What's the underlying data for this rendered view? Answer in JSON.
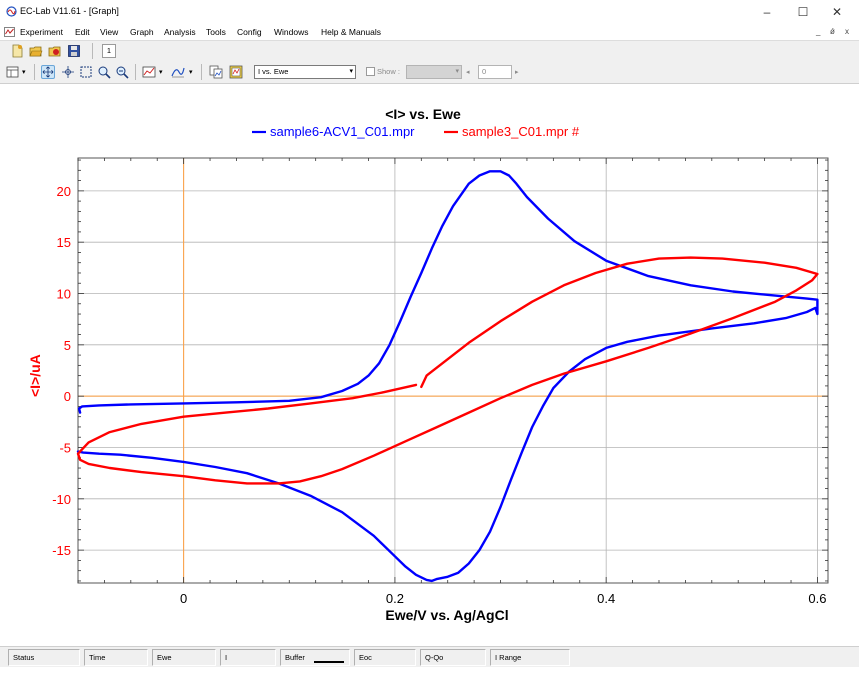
{
  "window": {
    "title": "EC-Lab V11.61 - [Graph]",
    "controls": [
      "–",
      "☐",
      "✕"
    ],
    "mdi_controls": [
      "_",
      "ǿ",
      "x"
    ]
  },
  "menubar": {
    "items": [
      "Experiment",
      "Edit",
      "View",
      "Graph",
      "Analysis",
      "Tools",
      "Config",
      "Windows",
      "Help & Manuals"
    ]
  },
  "toolbar": {
    "page_tab": "1",
    "graph_select": "I vs. Ewe",
    "show_label": "Show :",
    "spin_value": "0"
  },
  "statusbar": {
    "fields": [
      "Status",
      "Time",
      "Ewe",
      "I",
      "Buffer",
      "Eoc",
      "Q-Qo",
      "I Range"
    ]
  },
  "chart_data": {
    "type": "line",
    "title": "<I> vs. Ewe",
    "xlabel": "Ewe/V vs. Ag/AgCl",
    "ylabel": "<I>/uA",
    "xlim": [
      -0.1,
      0.61
    ],
    "ylim": [
      -18.2,
      23.2
    ],
    "xticks": [
      0,
      0.2,
      0.4,
      0.6
    ],
    "xtick_labels": [
      "0",
      "0.2",
      "0.4",
      "0.6"
    ],
    "yticks": [
      -15,
      -10,
      -5,
      0,
      5,
      10,
      15,
      20
    ],
    "ytick_labels": [
      "-15",
      "-10",
      "-5",
      "0",
      "5",
      "10",
      "15",
      "20"
    ],
    "grid": true,
    "legend_position": "top-center",
    "colors": {
      "axis_label": "#ff0000",
      "zero_line": "#ffa040",
      "grid": "#b4b4b4"
    },
    "series": [
      {
        "name": "sample6-ACV1_C01.mpr",
        "color": "#0000ff",
        "x": [
          -0.098,
          -0.099,
          -0.096,
          -0.08,
          -0.05,
          0,
          0.05,
          0.1,
          0.13,
          0.15,
          0.165,
          0.175,
          0.185,
          0.195,
          0.205,
          0.215,
          0.225,
          0.235,
          0.245,
          0.255,
          0.27,
          0.28,
          0.29,
          0.3,
          0.308,
          0.315,
          0.325,
          0.345,
          0.37,
          0.4,
          0.44,
          0.48,
          0.52,
          0.56,
          0.59,
          0.6,
          0.6,
          0.598,
          0.59,
          0.57,
          0.54,
          0.5,
          0.45,
          0.42,
          0.4,
          0.38,
          0.365,
          0.35,
          0.34,
          0.33,
          0.32,
          0.31,
          0.3,
          0.29,
          0.28,
          0.27,
          0.26,
          0.25,
          0.24,
          0.235,
          0.23,
          0.22,
          0.21,
          0.2,
          0.18,
          0.15,
          0.12,
          0.09,
          0.06,
          0.03,
          0,
          -0.03,
          -0.06,
          -0.08,
          -0.095,
          -0.1
        ],
        "y": [
          -1.6,
          -1.2,
          -1.0,
          -0.9,
          -0.8,
          -0.7,
          -0.6,
          -0.45,
          -0.1,
          0.5,
          1.2,
          2.0,
          3.2,
          5.0,
          7.3,
          9.7,
          12.0,
          14.4,
          16.6,
          18.5,
          20.7,
          21.5,
          21.9,
          21.9,
          21.5,
          20.7,
          19.4,
          17.3,
          15.1,
          13.2,
          11.7,
          10.8,
          10.2,
          9.8,
          9.5,
          9.4,
          8.0,
          8.6,
          8.2,
          7.6,
          7.1,
          6.6,
          5.9,
          5.3,
          4.7,
          3.6,
          2.4,
          0.8,
          -1.0,
          -3.0,
          -5.5,
          -8.1,
          -10.8,
          -13.2,
          -15.0,
          -16.3,
          -17.2,
          -17.6,
          -17.8,
          -18.0,
          -17.9,
          -17.4,
          -16.6,
          -15.6,
          -13.6,
          -11.3,
          -9.7,
          -8.5,
          -7.5,
          -6.9,
          -6.4,
          -6.0,
          -5.7,
          -5.6,
          -5.5,
          -5.4
        ]
      },
      {
        "name": "sample3_C01.mpr #",
        "color": "#ff0000",
        "x": [
          0.22,
          0.19,
          0.16,
          0.12,
          0.08,
          0.04,
          0,
          -0.04,
          -0.07,
          -0.09,
          -0.1,
          -0.098,
          -0.09,
          -0.07,
          -0.04,
          0,
          0.03,
          0.06,
          0.09,
          0.11,
          0.13,
          0.15,
          0.18,
          0.21,
          0.24,
          0.27,
          0.3,
          0.33,
          0.36,
          0.4,
          0.44,
          0.48,
          0.52,
          0.56,
          0.58,
          0.595,
          0.6,
          0.6,
          0.58,
          0.55,
          0.51,
          0.48,
          0.45,
          0.42,
          0.39,
          0.36,
          0.33,
          0.3,
          0.27,
          0.25,
          0.23,
          0.225
        ],
        "y": [
          1.1,
          0.4,
          -0.2,
          -0.7,
          -1.2,
          -1.6,
          -2.0,
          -2.7,
          -3.5,
          -4.5,
          -5.6,
          -6.2,
          -6.6,
          -7.0,
          -7.4,
          -7.8,
          -8.2,
          -8.5,
          -8.5,
          -8.3,
          -7.8,
          -7.1,
          -5.8,
          -4.4,
          -3.0,
          -1.6,
          -0.2,
          1.1,
          2.2,
          3.4,
          4.7,
          6.1,
          7.6,
          9.2,
          10.3,
          11.3,
          11.9,
          11.9,
          12.5,
          13.0,
          13.4,
          13.5,
          13.4,
          12.9,
          12.0,
          10.8,
          9.2,
          7.3,
          5.2,
          3.6,
          2.0,
          0.9
        ]
      }
    ]
  },
  "status_labels": {
    "status": "Status",
    "time": "Time",
    "ewe": "Ewe",
    "i": "I",
    "buffer": "Buffer",
    "eoc": "Eoc",
    "qqo": "Q-Qo",
    "irange": "I Range"
  }
}
